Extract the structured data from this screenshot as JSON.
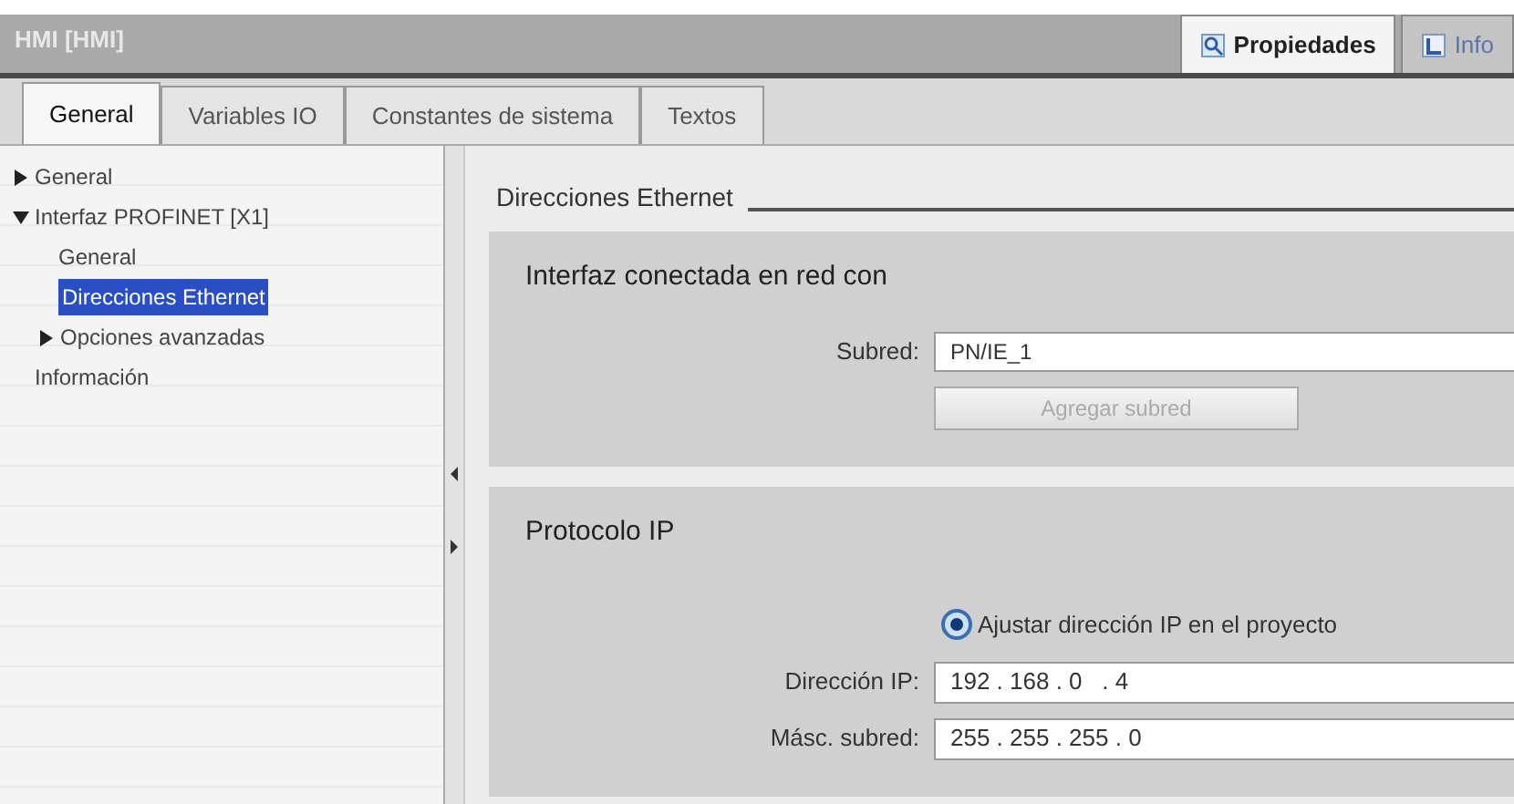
{
  "window": {
    "title": "HMI [HMI]"
  },
  "inspector_tabs": [
    {
      "label": "Propiedades",
      "selected": true
    },
    {
      "label": "Info",
      "selected": false
    }
  ],
  "tabs": [
    {
      "label": "General",
      "selected": true
    },
    {
      "label": "Variables IO",
      "selected": false
    },
    {
      "label": "Constantes de sistema",
      "selected": false
    },
    {
      "label": "Textos",
      "selected": false
    }
  ],
  "sidebar": {
    "items": [
      {
        "label": "General",
        "expanded": false,
        "selected": false
      },
      {
        "label": "Interfaz PROFINET [X1]",
        "expanded": true,
        "selected": false,
        "children": [
          {
            "label": "General",
            "selected": false
          },
          {
            "label": "Direcciones Ethernet",
            "selected": true
          },
          {
            "label": "Opciones avanzadas",
            "expanded": false,
            "selected": false
          }
        ]
      },
      {
        "label": "Información",
        "selected": false
      }
    ]
  },
  "section_title": "Direcciones Ethernet",
  "panels": [
    {
      "title": "Interfaz conectada en red con",
      "rows": [
        {
          "kind": "field",
          "label": "Subred:",
          "value": "PN/IE_1"
        },
        {
          "kind": "button",
          "label": "Agregar subred",
          "disabled": true
        }
      ]
    },
    {
      "title": "Protocolo IP",
      "rows": [
        {
          "kind": "radio",
          "label": "Ajustar dirección IP en el proyecto",
          "selected": true
        },
        {
          "kind": "ip",
          "label": "Dirección IP:",
          "value": "192 . 168 . 0   . 4"
        },
        {
          "kind": "ip",
          "label": "Másc. subred:",
          "value": "255 . 255 . 255 . 0"
        }
      ]
    }
  ]
}
